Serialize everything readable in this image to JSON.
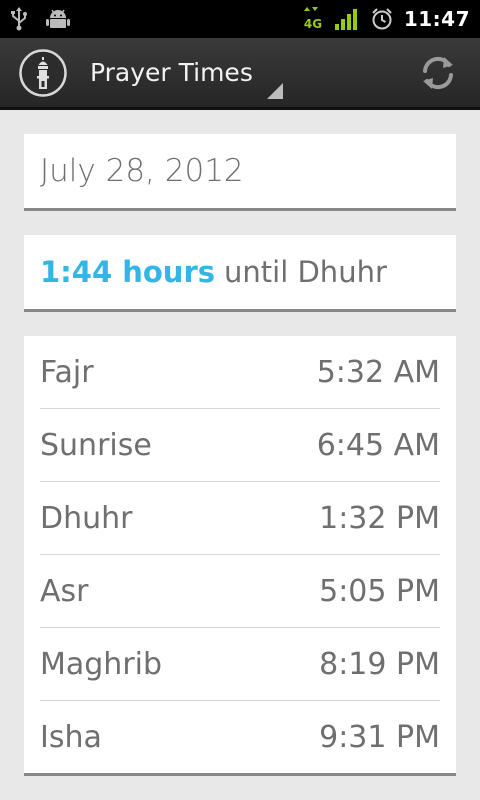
{
  "status_bar": {
    "time": "11:47",
    "network": "4G"
  },
  "action_bar": {
    "title": "Prayer Times"
  },
  "date": "July 28, 2012",
  "countdown": {
    "hours": "1:44 hours",
    "suffix": "until Dhuhr"
  },
  "prayers": [
    {
      "name": "Fajr",
      "time": "5:32 AM"
    },
    {
      "name": "Sunrise",
      "time": "6:45 AM"
    },
    {
      "name": "Dhuhr",
      "time": "1:32 PM"
    },
    {
      "name": "Asr",
      "time": "5:05 PM"
    },
    {
      "name": "Maghrib",
      "time": "8:19 PM"
    },
    {
      "name": "Isha",
      "time": "9:31 PM"
    }
  ],
  "colors": {
    "accent": "#33b5e5",
    "signal": "#99cc00"
  }
}
